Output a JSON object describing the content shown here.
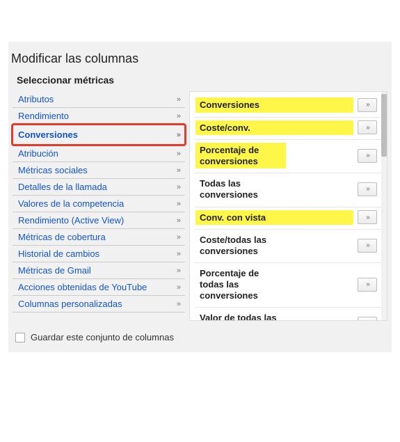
{
  "title": "Modificar las columnas",
  "subtitle": "Seleccionar métricas",
  "chevron": "»",
  "categories": [
    {
      "label": "Atributos",
      "selected": false
    },
    {
      "label": "Rendimiento",
      "selected": false
    },
    {
      "label": "Conversiones",
      "selected": true
    },
    {
      "label": "Atribución",
      "selected": false
    },
    {
      "label": "Métricas sociales",
      "selected": false
    },
    {
      "label": "Detalles de la llamada",
      "selected": false
    },
    {
      "label": "Valores de la competencia",
      "selected": false
    },
    {
      "label": "Rendimiento (Active View)",
      "selected": false
    },
    {
      "label": "Métricas de cobertura",
      "selected": false
    },
    {
      "label": "Historial de cambios",
      "selected": false
    },
    {
      "label": "Métricas de Gmail",
      "selected": false
    },
    {
      "label": "Acciones obtenidas de YouTube",
      "selected": false
    },
    {
      "label": "Columnas personalizadas",
      "selected": false
    }
  ],
  "metrics": [
    {
      "label": "Conversiones",
      "highlight": true
    },
    {
      "label": "Coste/conv.",
      "highlight": true
    },
    {
      "label": "Porcentaje de conversiones",
      "highlight": true
    },
    {
      "label": "Todas las conversiones",
      "highlight": false
    },
    {
      "label": "Conv. con vista",
      "highlight": true
    },
    {
      "label": "Coste/todas las conversiones",
      "highlight": false
    },
    {
      "label": "Porcentaje de todas las conversiones",
      "highlight": false
    },
    {
      "label": "Valor de todas las conversiones",
      "highlight": false
    }
  ],
  "save_checkbox_label": "Guardar este conjunto de columnas"
}
